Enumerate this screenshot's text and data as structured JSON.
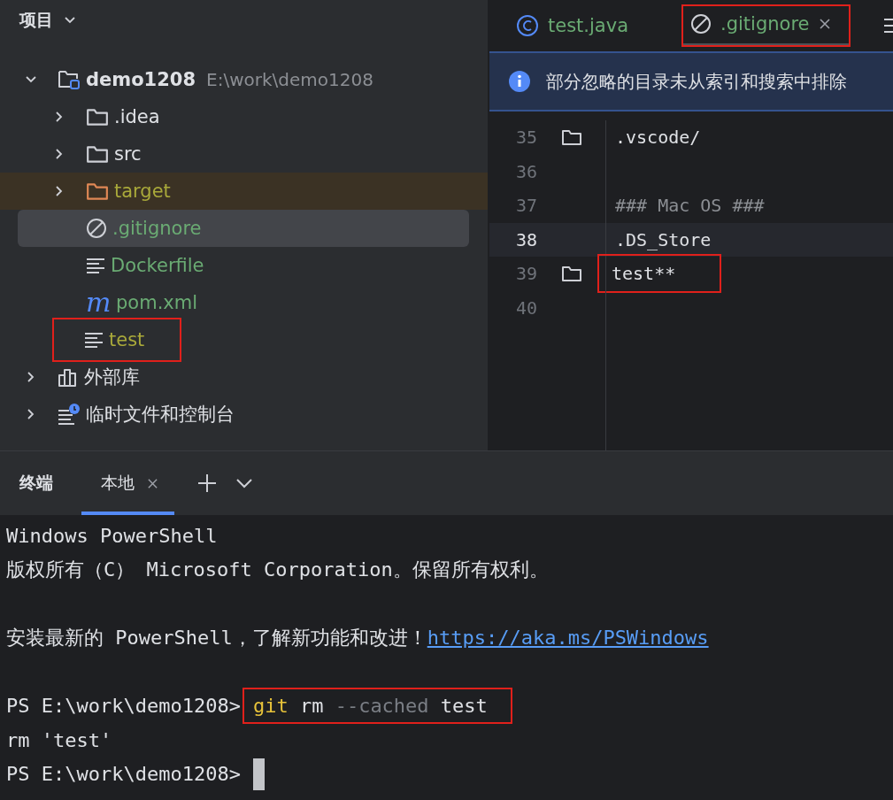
{
  "project_panel": {
    "title": "项目",
    "tree": [
      {
        "name": "demo1208",
        "path": "E:\\work\\demo1208",
        "kind": "project",
        "color": "#dfe1e5",
        "expanded": true,
        "selected": false,
        "excluded": false,
        "highlighted": false,
        "children": [
          {
            "name": ".idea",
            "kind": "folder",
            "color": "#dfe1e5",
            "expanded": false,
            "selected": false,
            "excluded": false,
            "highlighted": false
          },
          {
            "name": "src",
            "kind": "folder",
            "color": "#dfe1e5",
            "expanded": false,
            "selected": false,
            "excluded": false,
            "highlighted": false
          },
          {
            "name": "target",
            "kind": "excluded-folder",
            "color": "#a9a93a",
            "expanded": false,
            "selected": false,
            "excluded": true,
            "highlighted": false
          },
          {
            "name": ".gitignore",
            "kind": "ignore",
            "color": "#6aab73",
            "selected": true,
            "excluded": false,
            "highlighted": false
          },
          {
            "name": "Dockerfile",
            "kind": "text",
            "color": "#6aab73",
            "selected": false,
            "excluded": false,
            "highlighted": false
          },
          {
            "name": "pom.xml",
            "kind": "glyph",
            "glyph": "m",
            "color": "#6aab73",
            "selected": false,
            "excluded": false,
            "highlighted": false
          },
          {
            "name": "test",
            "kind": "text",
            "color": "#a9a93a",
            "selected": false,
            "excluded": false,
            "highlighted": true
          }
        ]
      },
      {
        "name": "外部库",
        "kind": "library",
        "color": "#dfe1e5",
        "expanded": false,
        "selected": false,
        "excluded": false,
        "highlighted": false
      },
      {
        "name": "临时文件和控制台",
        "kind": "scratch",
        "color": "#dfe1e5",
        "expanded": false,
        "selected": false,
        "excluded": false,
        "highlighted": false
      }
    ]
  },
  "editor": {
    "tabs": [
      {
        "label": "test.java",
        "kind": "class",
        "color": "#6aab73",
        "selected": false,
        "highlighted": false,
        "closable": false
      },
      {
        "label": ".gitignore",
        "kind": "ignore",
        "color": "#6aab73",
        "selected": true,
        "highlighted": true,
        "closable": true
      }
    ],
    "banner": "部分忽略的目录未从索引和搜索中排除",
    "lines": [
      {
        "number": "35",
        "folder": true,
        "text": ".vscode/",
        "kind": "pattern",
        "current": false,
        "highlighted": false
      },
      {
        "number": "36",
        "folder": false,
        "current": false
      },
      {
        "number": "37",
        "folder": false,
        "text": "### Mac OS ###",
        "kind": "comment",
        "current": false,
        "highlighted": false
      },
      {
        "number": "38",
        "folder": false,
        "text": ".DS_Store",
        "kind": "pattern",
        "current": true,
        "highlighted": false
      },
      {
        "number": "39",
        "folder": true,
        "text": "test**",
        "kind": "pattern",
        "current": false,
        "highlighted": true
      },
      {
        "number": "40",
        "folder": false,
        "current": false
      }
    ]
  },
  "terminal": {
    "title": "终端",
    "tabs": [
      {
        "label": "本地",
        "selected": true,
        "closable": true
      }
    ],
    "lines": [
      {
        "segments": [
          {
            "text": "Windows PowerShell",
            "kind": "plain"
          }
        ],
        "space_before": false,
        "cursor": false
      },
      {
        "segments": [
          {
            "text": "版权所有（C） Microsoft Corporation。保留所有权利。",
            "kind": "plain"
          }
        ],
        "space_before": false,
        "cursor": false
      },
      {
        "segments": [
          {
            "text": "安装最新的 PowerShell，了解新功能和改进！",
            "kind": "plain"
          },
          {
            "text": "https://aka.ms/PSWindows",
            "kind": "link"
          }
        ],
        "space_before": true,
        "cursor": false
      },
      {
        "prompt": "PS E:\\work\\demo1208>",
        "command": [
          {
            "text": "git",
            "kind": "command"
          },
          {
            "text": " rm ",
            "kind": "plain"
          },
          {
            "text": "--cached",
            "kind": "flag"
          },
          {
            "text": " test",
            "kind": "plain"
          }
        ],
        "highlighted": true,
        "space_before": true,
        "cursor": false
      },
      {
        "segments": [
          {
            "text": "rm 'test'",
            "kind": "plain"
          }
        ],
        "space_before": false,
        "cursor": false
      },
      {
        "prompt": "PS E:\\work\\demo1208>",
        "space_before": false,
        "cursor": true
      }
    ]
  }
}
